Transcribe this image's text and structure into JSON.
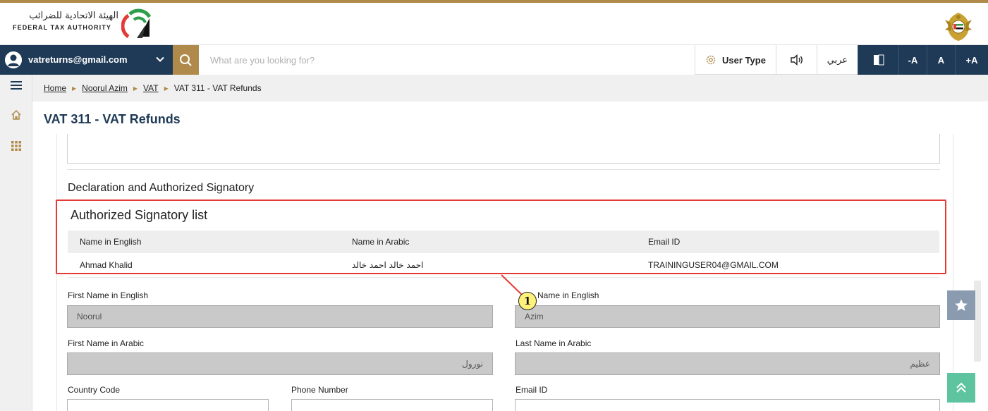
{
  "header": {
    "logo_arabic": "الهيئة الاتحادية للضرائب",
    "logo_english": "FEDERAL TAX AUTHORITY",
    "emblem_icon": "uae-emblem-icon"
  },
  "toolbar": {
    "user_email": "vatreturns@gmail.com",
    "search_placeholder": "What are you looking for?",
    "user_type_label": "User Type",
    "arabic_label": "عربي",
    "font_minus": "-A",
    "font_normal": "A",
    "font_plus": "+A"
  },
  "breadcrumb": {
    "items": [
      "Home",
      "Noorul Azim",
      "VAT",
      "VAT 311 - VAT Refunds"
    ]
  },
  "page": {
    "title": "VAT 311 - VAT Refunds"
  },
  "declaration": {
    "section_title": "Declaration and Authorized Signatory",
    "list_title": "Authorized Signatory list",
    "columns": [
      "Name in English",
      "Name in Arabic",
      "Email ID"
    ],
    "rows": [
      [
        "Ahmad Khalid",
        "احمد خالد احمد خالد",
        "TRAININGUSER04@GMAIL.COM"
      ]
    ]
  },
  "annotation": {
    "marker": "1"
  },
  "form": {
    "first_name_en_label": "First Name in English",
    "first_name_en_value": "Noorul",
    "last_name_en_label": "Last Name in English",
    "last_name_en_visible": "Name in English",
    "last_name_en_value": "Azim",
    "first_name_ar_label": "First Name in Arabic",
    "first_name_ar_value": "نورول",
    "last_name_ar_label": "Last Name in Arabic",
    "last_name_ar_value": "عظيم",
    "country_code_label": "Country Code",
    "phone_label": "Phone Number",
    "email_label": "Email ID"
  },
  "colors": {
    "navy": "#1f3a56",
    "gold": "#b08a4a",
    "annotation_red": "#e53935",
    "scroll_top_green": "#5ec4a0"
  }
}
